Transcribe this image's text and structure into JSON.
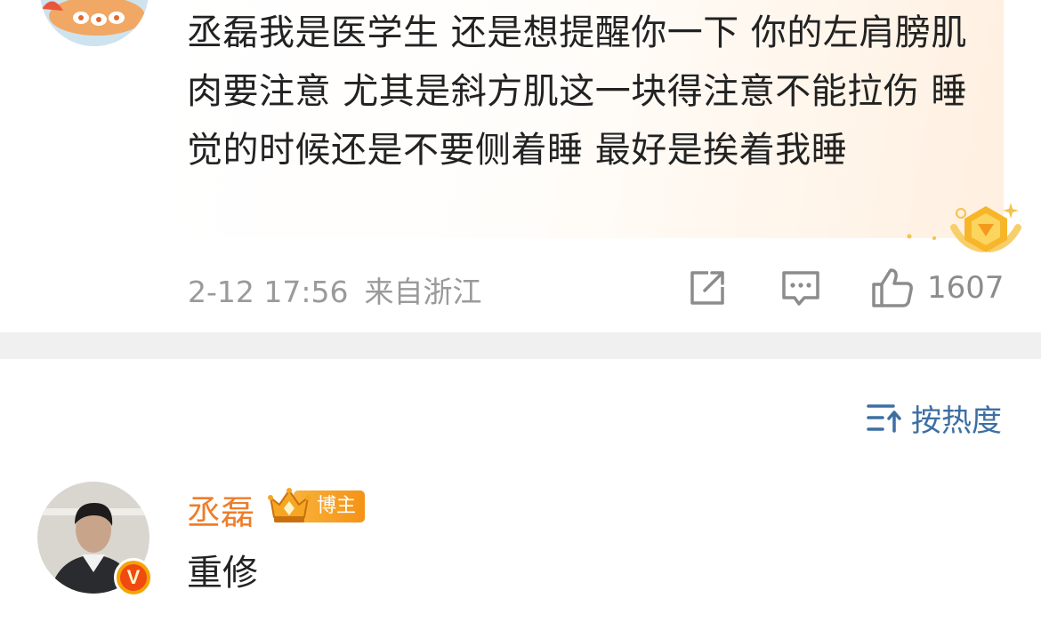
{
  "comment": {
    "text": "丞磊我是医学生 还是想提醒你一下 你的左肩膀肌肉要注意 尤其是斜方肌这一块得注意不能拉伤 睡觉的时候还是不要侧着睡 最好是挨着我睡",
    "date": "2-12 17:56",
    "location": "来自浙江",
    "like_count": "1607",
    "icons": {
      "share": "share-icon",
      "reply": "comment-icon",
      "like": "thumbs-up-icon"
    }
  },
  "sort": {
    "label": "按热度",
    "icon": "sort-icon"
  },
  "reply": {
    "user_name": "丞磊",
    "role_tag": "博主",
    "text": "重修",
    "verified_badge": "V"
  },
  "colors": {
    "accent_orange": "#ee7d2b",
    "link_blue": "#3d6ea3",
    "meta_gray": "#9a9a9a",
    "divider": "#f0f0f0",
    "badge_orange": "#f59216"
  }
}
